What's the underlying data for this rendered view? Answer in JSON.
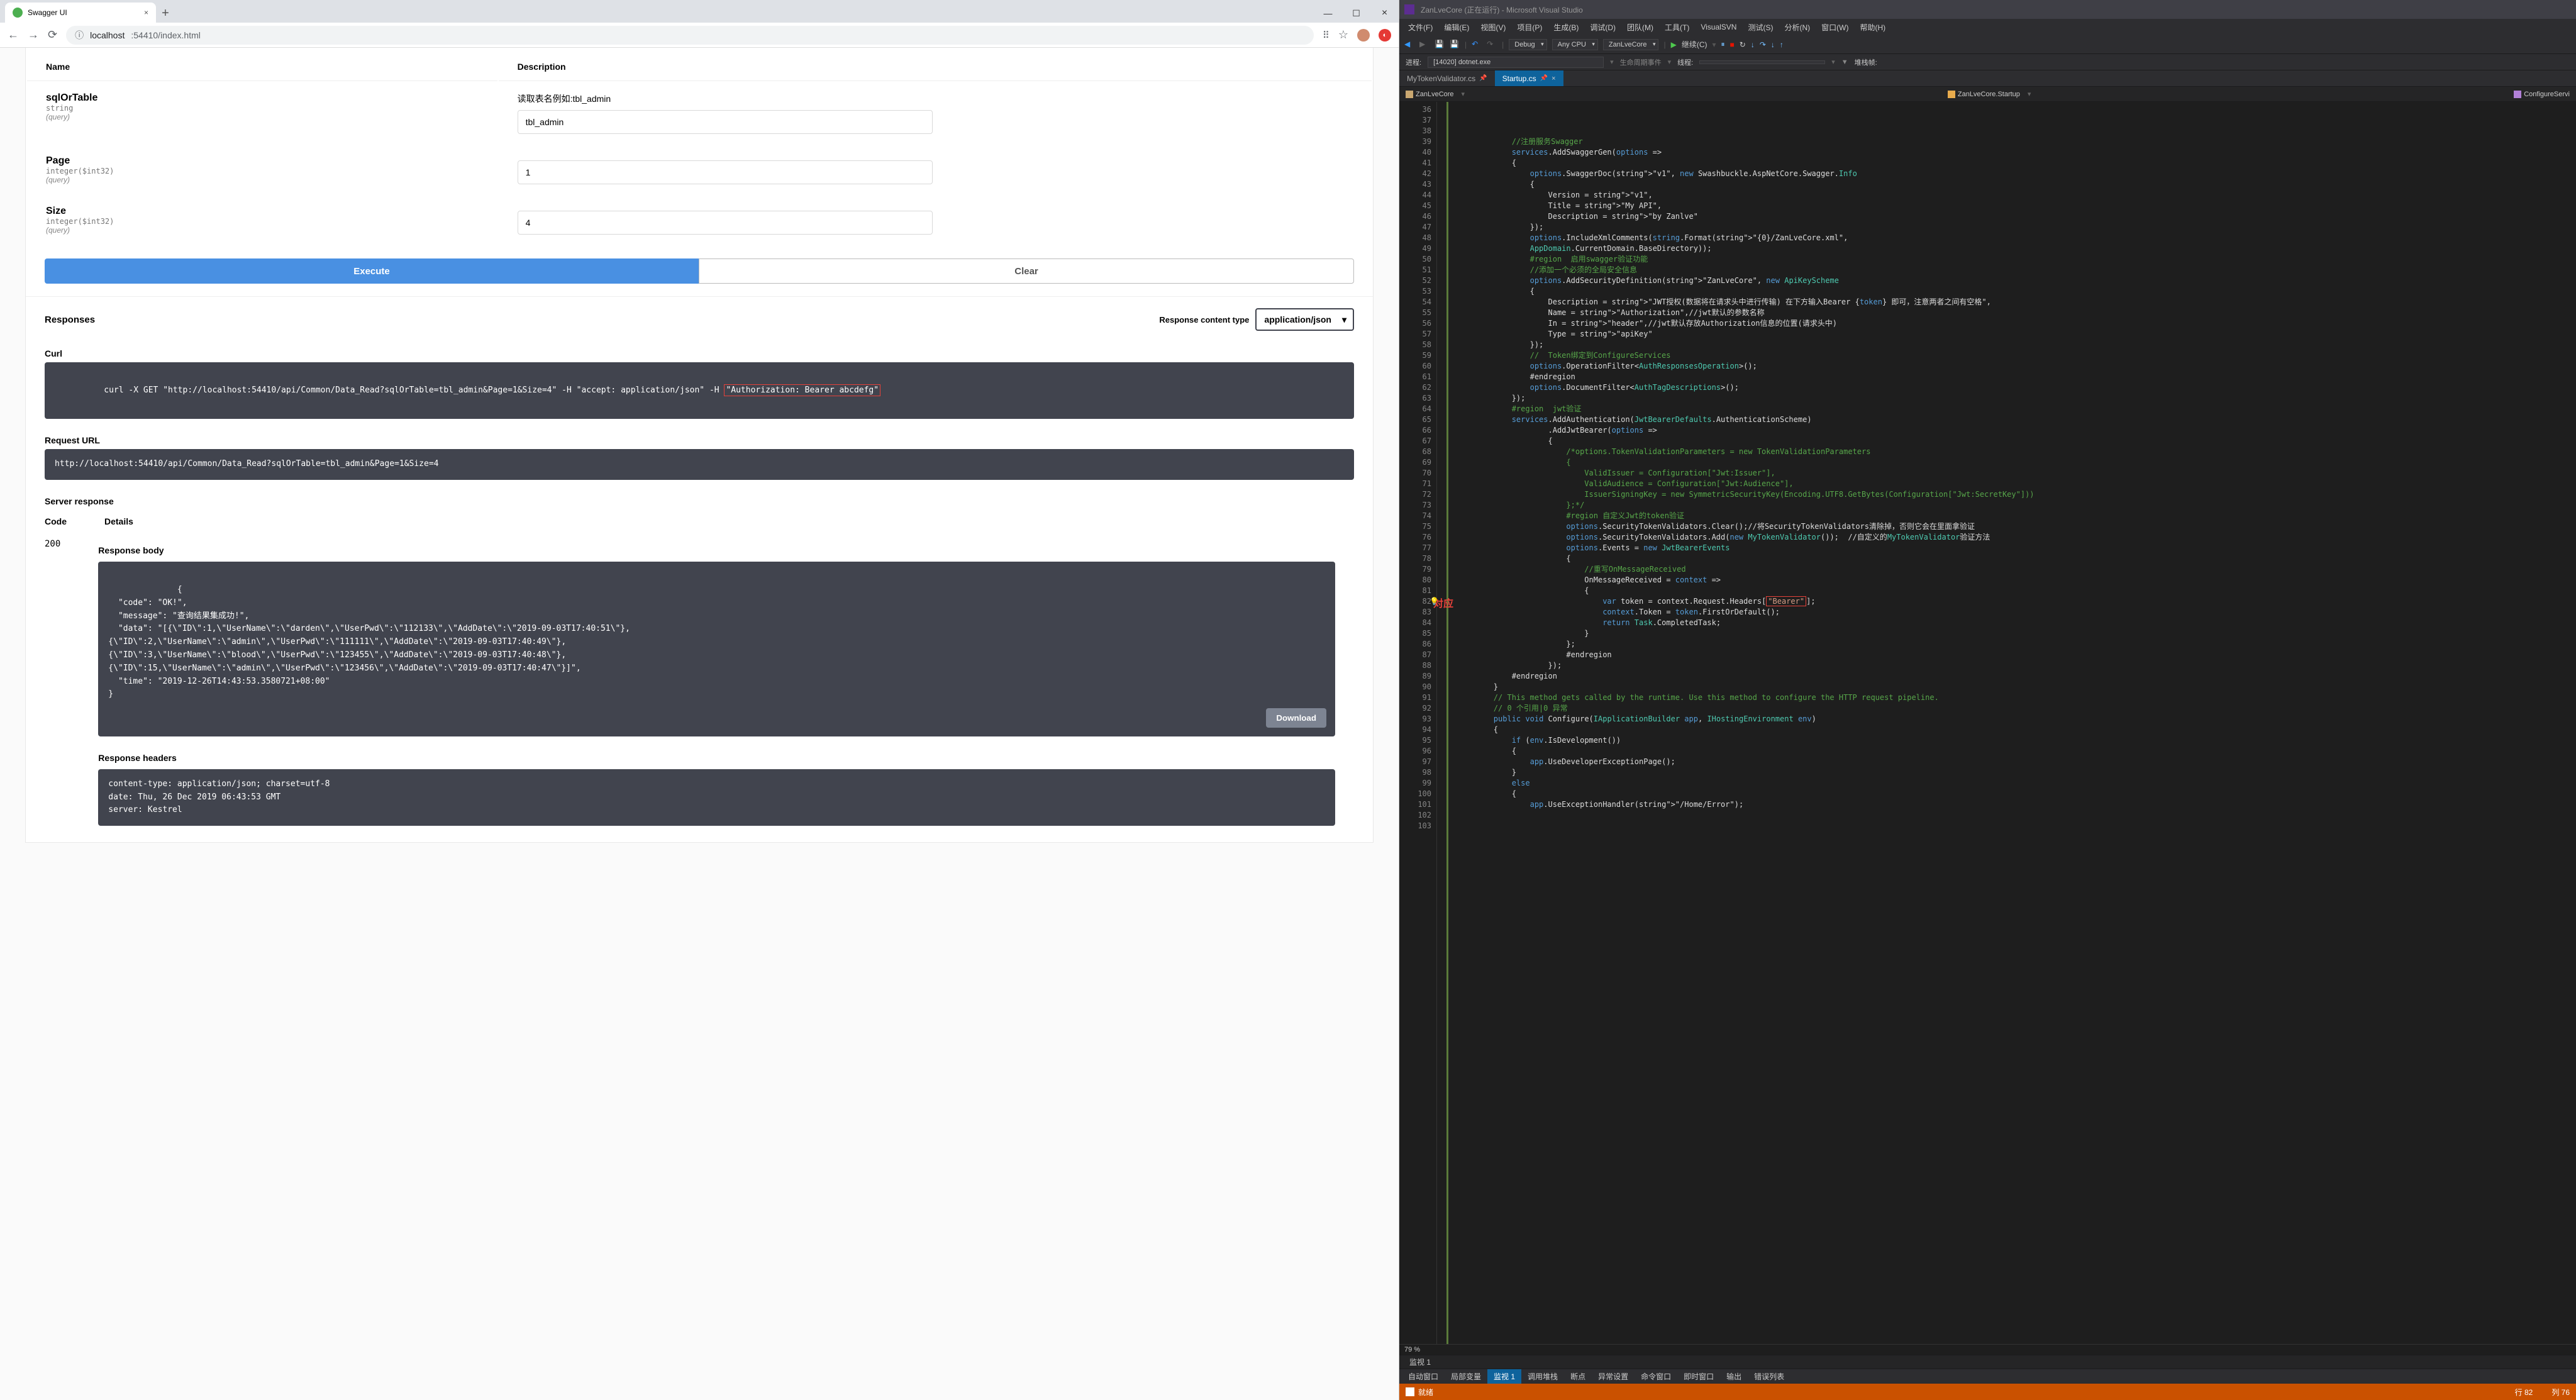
{
  "browser": {
    "tab_title": "Swagger UI",
    "url_host": "localhost",
    "url_rest": ":54410/index.html"
  },
  "swagger": {
    "th_name": "Name",
    "th_desc": "Description",
    "params": {
      "p1_name": "sqlOrTable",
      "p1_type": "string",
      "p1_meta": "(query)",
      "p1_desc": "读取表名例如:tbl_admin",
      "p1_val": "tbl_admin",
      "p2_name": "Page",
      "p2_type": "integer($int32)",
      "p2_meta": "(query)",
      "p2_val": "1",
      "p3_name": "Size",
      "p3_type": "integer($int32)",
      "p3_meta": "(query)",
      "p3_val": "4"
    },
    "btn_execute": "Execute",
    "btn_clear": "Clear",
    "responses_hdr": "Responses",
    "rct_label": "Response content type",
    "rct_value": "application/json",
    "curl_label": "Curl",
    "curl_pre": "curl -X GET \"http://localhost:54410/api/Common/Data_Read?sqlOrTable=tbl_admin&Page=1&Size=4\" -H \"accept: application/json\" -H ",
    "curl_hl": "\"Authorization: Bearer abcdefg\"",
    "requrl_label": "Request URL",
    "requrl_value": "http://localhost:54410/api/Common/Data_Read?sqlOrTable=tbl_admin&Page=1&Size=4",
    "srvresp_label": "Server response",
    "code_hdr": "Code",
    "details_hdr": "Details",
    "code_val": "200",
    "respbody_label": "Response body",
    "respbody": "{\n  \"code\": \"OK!\",\n  \"message\": \"查询结果集成功!\",\n  \"data\": \"[{\\\"ID\\\":1,\\\"UserName\\\":\\\"darden\\\",\\\"UserPwd\\\":\\\"112133\\\",\\\"AddDate\\\":\\\"2019-09-03T17:40:51\\\"},\n{\\\"ID\\\":2,\\\"UserName\\\":\\\"admin\\\",\\\"UserPwd\\\":\\\"111111\\\",\\\"AddDate\\\":\\\"2019-09-03T17:40:49\\\"},\n{\\\"ID\\\":3,\\\"UserName\\\":\\\"blood\\\",\\\"UserPwd\\\":\\\"123455\\\",\\\"AddDate\\\":\\\"2019-09-03T17:40:48\\\"},\n{\\\"ID\\\":15,\\\"UserName\\\":\\\"admin\\\",\\\"UserPwd\\\":\\\"123456\\\",\\\"AddDate\\\":\\\"2019-09-03T17:40:47\\\"}]\",\n  \"time\": \"2019-12-26T14:43:53.3580721+08:00\"\n}",
    "download": "Download",
    "resph_label": "Response headers",
    "resph": "content-type: application/json; charset=utf-8\ndate: Thu, 26 Dec 2019 06:43:53 GMT\nserver: Kestrel"
  },
  "vs": {
    "title": "ZanLveCore (正在运行) - Microsoft Visual Studio",
    "menu": [
      "文件(F)",
      "编辑(E)",
      "视图(V)",
      "项目(P)",
      "生成(B)",
      "调试(D)",
      "团队(M)",
      "工具(T)",
      "VisualSVN",
      "测试(S)",
      "分析(N)",
      "窗口(W)",
      "帮助(H)"
    ],
    "tb_debug": "Debug",
    "tb_cpu": "Any CPU",
    "tb_project": "ZanLveCore",
    "tb_continue": "继续(C)",
    "proc_label": "进程:",
    "proc_val": "[14020] dotnet.exe",
    "lifecycle": "生命周期事件",
    "thread_label": "线程:",
    "stack_label": "堆栈帧:",
    "tab1": "MyTokenValidator.cs",
    "tab2": "Startup.cs",
    "crumb1": "ZanLveCore",
    "crumb2": "ZanLveCore.Startup",
    "crumb3": "ConfigureServi",
    "red_annotation": "对应",
    "zoom": "79 %",
    "watch_title": "监视 1",
    "bottom_tabs": [
      "自动窗口",
      "局部变量",
      "监视 1",
      "调用堆栈",
      "断点",
      "异常设置",
      "命令窗口",
      "即时窗口",
      "输出",
      "错误列表"
    ],
    "status_ready": "就绪",
    "status_row": "行 82",
    "status_col": "列 76"
  },
  "code_lines": [
    {
      "n": 36,
      "t": "            //注册服务Swagger",
      "cls": "c-comment"
    },
    {
      "n": 37,
      "t": "            services.AddSwaggerGen(options =>"
    },
    {
      "n": 38,
      "t": "            {"
    },
    {
      "n": 39,
      "t": "                options.SwaggerDoc(\"v1\", new Swashbuckle.AspNetCore.Swagger.Info"
    },
    {
      "n": 40,
      "t": "                {"
    },
    {
      "n": 41,
      "t": "                    Version = \"v1\","
    },
    {
      "n": 42,
      "t": "                    Title = \"My API\","
    },
    {
      "n": 43,
      "t": "                    Description = \"by Zanlve\""
    },
    {
      "n": 44,
      "t": "                });"
    },
    {
      "n": 45,
      "t": "                options.IncludeXmlComments(string.Format(\"{0}/ZanLveCore.xml\","
    },
    {
      "n": 46,
      "t": "                AppDomain.CurrentDomain.BaseDirectory));"
    },
    {
      "n": 47,
      "t": ""
    },
    {
      "n": 48,
      "t": "                #region  启用swagger验证功能",
      "cls": "c-comment"
    },
    {
      "n": 49,
      "t": "                //添加一个必须的全局安全信息",
      "cls": "c-comment"
    },
    {
      "n": 50,
      "t": "                options.AddSecurityDefinition(\"ZanLveCore\", new ApiKeyScheme"
    },
    {
      "n": 51,
      "t": "                {"
    },
    {
      "n": 52,
      "t": "                    Description = \"JWT授权(数据将在请求头中进行传输) 在下方输入Bearer {token} 即可，注意两者之间有空格\","
    },
    {
      "n": 53,
      "t": "                    Name = \"Authorization\",//jwt默认的参数名称"
    },
    {
      "n": 54,
      "t": "                    In = \"header\",//jwt默认存放Authorization信息的位置(请求头中)"
    },
    {
      "n": 55,
      "t": "                    Type = \"apiKey\""
    },
    {
      "n": 56,
      "t": "                });"
    },
    {
      "n": 57,
      "t": "                //  Token绑定到ConfigureServices",
      "cls": "c-comment"
    },
    {
      "n": 58,
      "t": "                options.OperationFilter<AuthResponsesOperation>();"
    },
    {
      "n": 59,
      "t": "                #endregion"
    },
    {
      "n": 60,
      "t": "                options.DocumentFilter<AuthTagDescriptions>();"
    },
    {
      "n": 61,
      "t": ""
    },
    {
      "n": 62,
      "t": "            });"
    },
    {
      "n": 63,
      "t": "            #region  jwt验证",
      "cls": "c-comment"
    },
    {
      "n": 64,
      "t": "            services.AddAuthentication(JwtBearerDefaults.AuthenticationScheme)"
    },
    {
      "n": 65,
      "t": "                    .AddJwtBearer(options =>"
    },
    {
      "n": 66,
      "t": "                    {"
    },
    {
      "n": 67,
      "t": "                        /*options.TokenValidationParameters = new TokenValidationParameters",
      "cls": "c-comment"
    },
    {
      "n": 68,
      "t": "                        {",
      "cls": "c-comment"
    },
    {
      "n": 69,
      "t": "                            ValidIssuer = Configuration[\"Jwt:Issuer\"],",
      "cls": "c-comment"
    },
    {
      "n": 70,
      "t": "                            ValidAudience = Configuration[\"Jwt:Audience\"],",
      "cls": "c-comment"
    },
    {
      "n": 71,
      "t": "                            IssuerSigningKey = new SymmetricSecurityKey(Encoding.UTF8.GetBytes(Configuration[\"Jwt:SecretKey\"]))",
      "cls": "c-comment"
    },
    {
      "n": 72,
      "t": "                        };*/",
      "cls": "c-comment"
    },
    {
      "n": 73,
      "t": ""
    },
    {
      "n": 74,
      "t": "                        #region 自定义Jwt的token验证",
      "cls": "c-comment"
    },
    {
      "n": 75,
      "t": "                        options.SecurityTokenValidators.Clear();//将SecurityTokenValidators清除掉，否则它会在里面拿验证"
    },
    {
      "n": 76,
      "t": "                        options.SecurityTokenValidators.Add(new MyTokenValidator());  //自定义的MyTokenValidator验证方法"
    },
    {
      "n": 77,
      "t": "                        options.Events = new JwtBearerEvents"
    },
    {
      "n": 78,
      "t": "                        {"
    },
    {
      "n": 79,
      "t": "                            //重写OnMessageReceived",
      "cls": "c-comment"
    },
    {
      "n": 80,
      "t": "                            OnMessageReceived = context =>"
    },
    {
      "n": 81,
      "t": "                            {"
    },
    {
      "n": 82,
      "t": "                                var token = context.Request.Headers[\"Bearer\"];",
      "hl": true
    },
    {
      "n": 83,
      "t": "                                context.Token = token.FirstOrDefault();"
    },
    {
      "n": 84,
      "t": "                                return Task.CompletedTask;"
    },
    {
      "n": 85,
      "t": "                            }"
    },
    {
      "n": 86,
      "t": "                        };"
    },
    {
      "n": 87,
      "t": "                        #endregion"
    },
    {
      "n": 88,
      "t": ""
    },
    {
      "n": 89,
      "t": "                    });"
    },
    {
      "n": 90,
      "t": "            #endregion"
    },
    {
      "n": 91,
      "t": "        }"
    },
    {
      "n": 92,
      "t": ""
    },
    {
      "n": 93,
      "t": "        // This method gets called by the runtime. Use this method to configure the HTTP request pipeline.",
      "cls": "c-comment"
    },
    {
      "n": 94,
      "t": "        // 0 个引用|0 异常",
      "cls": "c-comment"
    },
    {
      "n": 95,
      "t": "        public void Configure(IApplicationBuilder app, IHostingEnvironment env)"
    },
    {
      "n": 96,
      "t": "        {"
    },
    {
      "n": 97,
      "t": "            if (env.IsDevelopment())"
    },
    {
      "n": 98,
      "t": "            {"
    },
    {
      "n": 99,
      "t": "                app.UseDeveloperExceptionPage();"
    },
    {
      "n": 100,
      "t": "            }"
    },
    {
      "n": 101,
      "t": "            else"
    },
    {
      "n": 102,
      "t": "            {"
    },
    {
      "n": 103,
      "t": "                app.UseExceptionHandler(\"/Home/Error\");"
    }
  ]
}
